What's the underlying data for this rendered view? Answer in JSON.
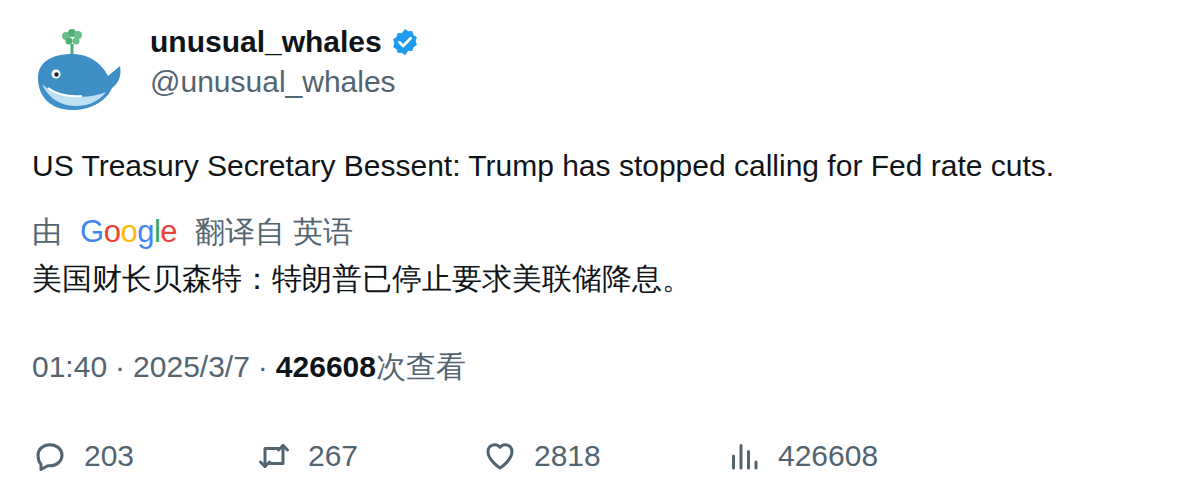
{
  "author": {
    "name": "unusual_whales",
    "handle": "@unusual_whales",
    "verified": true
  },
  "text": "US Treasury Secretary Bessent: Trump has stopped calling for Fed rate cuts.",
  "translation": {
    "prefix": "由",
    "service": "Google",
    "suffix": "翻译自 英语",
    "text": "美国财长贝森特：特朗普已停止要求美联储降息。"
  },
  "meta": {
    "time": "01:40",
    "separator": "·",
    "date": "2025/3/7",
    "views": "426608",
    "views_label": "次查看"
  },
  "actions": [
    {
      "kind": "reply",
      "count": "203"
    },
    {
      "kind": "retweet",
      "count": "267"
    },
    {
      "kind": "like",
      "count": "2818"
    },
    {
      "kind": "views",
      "count": "426608"
    }
  ]
}
